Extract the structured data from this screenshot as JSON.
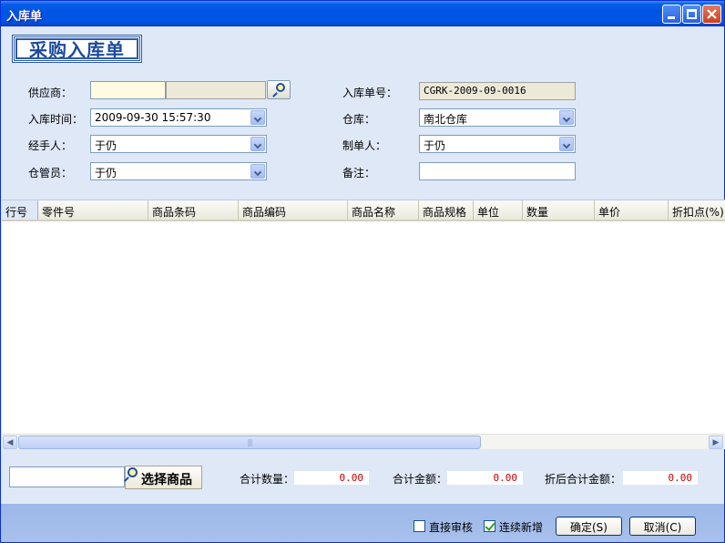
{
  "window": {
    "title": "入库单"
  },
  "header": {
    "logo_text": "采购入库单"
  },
  "form": {
    "supplier_label": "供应商：",
    "supplier_value": "",
    "time_label": "入库时间：",
    "time_value": "2009-09-30 15:57:30",
    "handler_label": "经手人：",
    "handler_value": "于仍",
    "keeper_label": "仓管员：",
    "keeper_value": "于仍",
    "order_no_label": "入库单号：",
    "order_no_value": "CGRK-2009-09-0016",
    "warehouse_label": "仓库：",
    "warehouse_value": "南北仓库",
    "creator_label": "制单人：",
    "creator_value": "于仍",
    "remark_label": "备注：",
    "remark_value": ""
  },
  "grid": {
    "columns": [
      "行号",
      "零件号",
      "商品条码",
      "商品编码",
      "商品名称",
      "商品规格",
      "单位",
      "数量",
      "单价",
      "折扣点(%)"
    ],
    "rows": [],
    "scroll_thumb_grip": "|||"
  },
  "bottom": {
    "select_button_label": "选择商品",
    "total_qty_label": "合计数量：",
    "total_qty_value": "0.00",
    "total_amount_label": "合计金额：",
    "total_amount_value": "0.00",
    "discounted_total_label": "折后合计金额：",
    "discounted_total_value": "0.00"
  },
  "footer": {
    "direct_audit_label": "直接审核",
    "direct_audit_checked": false,
    "continuous_add_label": "连续新增",
    "continuous_add_checked": true,
    "ok_label": "确定(S)",
    "cancel_label": "取消(C)"
  },
  "colors": {
    "titlebar": "#0054e3",
    "window_bg": "#dfe8f6",
    "footer_bg": "#a8c0ec",
    "total_value": "#c00000"
  }
}
